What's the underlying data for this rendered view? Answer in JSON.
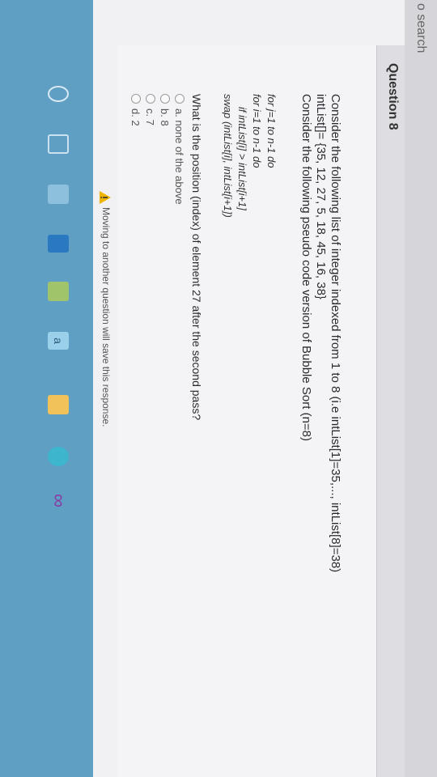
{
  "browser": {
    "search_text": "o search"
  },
  "question": {
    "title": "Question 8",
    "intro_lines": [
      "Consider the following list of integer indexed from 1 to 8 (i.e intList[1]=35,..., intList[8]=38)",
      "intList[]= {35, 12, 27, 5, 18, 45, 16, 38}",
      "Consider the following pseudo code version of Bubble Sort (n=8)"
    ],
    "code_lines": [
      "for j=1 to n-1 do",
      "for i=1 to n-1 do",
      "if intList[i] > intList[i+1]",
      "swap (intList[i], intList[i+1])"
    ],
    "prompt": "What is the position (index) of element 27 after the second pass?",
    "options": [
      "a. none of the above",
      "b. 8",
      "c. 7",
      "d. 2"
    ]
  },
  "notice": "Moving to another question will save this response.",
  "taskbar": {
    "icons": [
      "search-icon",
      "task-view-icon",
      "people-icon",
      "internet-explorer-icon",
      "file-explorer-icon",
      "a-app-icon",
      "store-icon",
      "globe-icon",
      "infinity-icon"
    ],
    "a_label": "a",
    "infinity_glyph": "∞",
    "bg_color": "#5f9fc4"
  }
}
